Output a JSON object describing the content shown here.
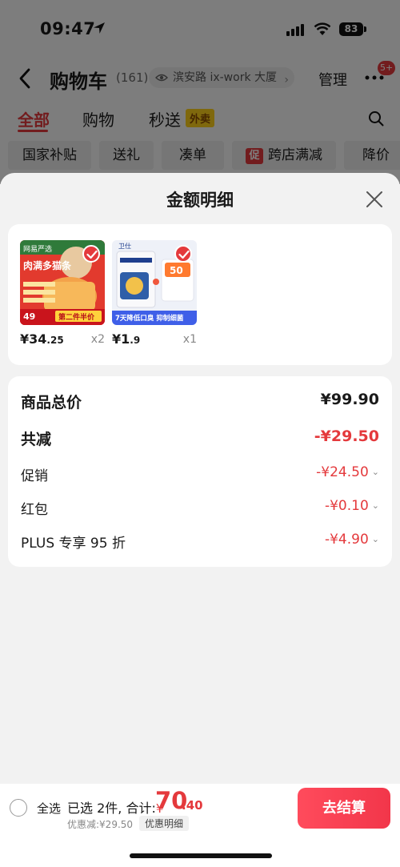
{
  "status": {
    "time": "09:47",
    "battery": "83"
  },
  "nav": {
    "title": "购物车",
    "count": "(161)",
    "address": "滨安路 ix-work 大厦",
    "manage": "管理",
    "badge": "5+"
  },
  "tabs": [
    {
      "label": "全部"
    },
    {
      "label": "购物"
    },
    {
      "label": "秒送"
    }
  ],
  "waimai_tag": "外卖",
  "chips": [
    {
      "label": "国家补贴"
    },
    {
      "label": "送礼"
    },
    {
      "label": "凑单"
    },
    {
      "label": "跨店满减"
    },
    {
      "label": "降价"
    }
  ],
  "promo_mark": "促",
  "sheet": {
    "title": "金额明细"
  },
  "products": [
    {
      "price_main": "¥34",
      "price_dec": ".25",
      "qty": "x2",
      "image_texts": {
        "brand": "网易严选",
        "title": "肉满多猫条",
        "price": "49",
        "banner": "第二件半价"
      }
    },
    {
      "price_main": "¥1",
      "price_dec": ".9",
      "qty": "x1",
      "image_texts": {
        "brand": "卫仕",
        "box": "50",
        "banner": "7天降低口臭 抑制细菌"
      }
    }
  ],
  "summary": [
    {
      "label": "商品总价",
      "value": "¥99.90",
      "style": "big",
      "red": false,
      "chevron": false
    },
    {
      "label": "共减",
      "value": "-¥29.50",
      "style": "big",
      "red": true,
      "chevron": false
    },
    {
      "label": "促销",
      "value": "-¥24.50",
      "style": "small",
      "red": true,
      "chevron": true
    },
    {
      "label": "红包",
      "value": "-¥0.10",
      "style": "small",
      "red": true,
      "chevron": true
    },
    {
      "label": "PLUS 专享 95 折",
      "value": "-¥4.90",
      "style": "small",
      "red": true,
      "chevron": true
    }
  ],
  "bottom": {
    "select_all": "全选",
    "selected": "已选 2件, 合计:",
    "yen": "¥",
    "total_int": "70",
    "total_dec": ".40",
    "saved": "优惠减:¥29.50",
    "detail": "优惠明细",
    "checkout": "去结算"
  },
  "colors": {
    "accent": "#e4393c",
    "checkout": "#f2364a",
    "sheet_bg": "#f2f2f2"
  }
}
